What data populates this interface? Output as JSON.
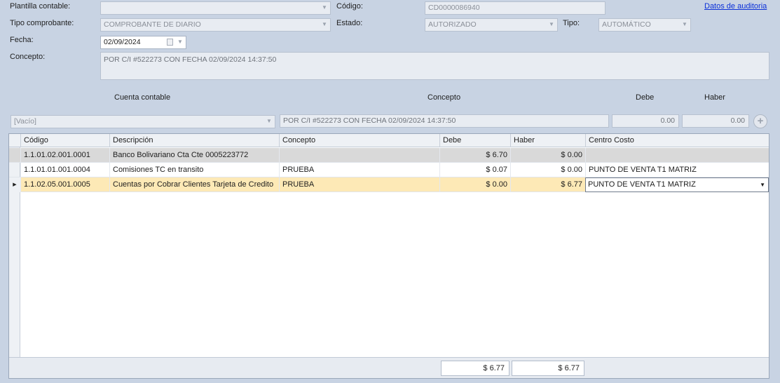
{
  "header": {
    "plantilla_label": "Plantilla contable:",
    "plantilla_value": "",
    "codigo_label": "Código:",
    "codigo_value": "CD0000086940",
    "auditoria_link": "Datos de auditoria",
    "tipo_comprobante_label": "Tipo comprobante:",
    "tipo_comprobante_value": "COMPROBANTE DE DIARIO",
    "estado_label": "Estado:",
    "estado_value": "AUTORIZADO",
    "tipo_label": "Tipo:",
    "tipo_value": "AUTOMÁTICO",
    "fecha_label": "Fecha:",
    "fecha_value": "02/09/2024",
    "concepto_label": "Concepto:",
    "concepto_value": "POR C/I #522273 CON FECHA 02/09/2024 14:37:50"
  },
  "entry": {
    "cuenta_header": "Cuenta contable",
    "concepto_header": "Concepto",
    "debe_header": "Debe",
    "haber_header": "Haber",
    "cuenta_value": "[Vacío]",
    "concepto_value": "POR C/I #522273 CON FECHA 02/09/2024 14:37:50",
    "debe_value": "0.00",
    "haber_value": "0.00",
    "add_icon": "plus-icon"
  },
  "grid": {
    "columns": {
      "codigo": "Código",
      "descripcion": "Descripción",
      "concepto": "Concepto",
      "debe": "Debe",
      "haber": "Haber",
      "centro": "Centro Costo"
    },
    "rows": [
      {
        "codigo": "1.1.01.02.001.0001",
        "descripcion": "Banco  Bolivariano Cta Cte 0005223772",
        "concepto": "",
        "debe": "$ 6.70",
        "haber": "$ 0.00",
        "centro": ""
      },
      {
        "codigo": "1.1.01.01.001.0004",
        "descripcion": "Comisiones TC en transito",
        "concepto": "PRUEBA",
        "debe": "$ 0.07",
        "haber": "$ 0.00",
        "centro": "PUNTO DE VENTA T1 MATRIZ"
      },
      {
        "codigo": "1.1.02.05.001.0005",
        "descripcion": "Cuentas por Cobrar Clientes Tarjeta de Credito",
        "concepto": "PRUEBA",
        "debe": "$ 0.00",
        "haber": "$ 6.77",
        "centro": "PUNTO DE VENTA T1 MATRIZ"
      }
    ],
    "total_debe": "$ 6.77",
    "total_haber": "$ 6.77"
  },
  "colors": {
    "background": "#c8d3e3",
    "selected_row": "#fde9b6",
    "link": "#0b30d8"
  }
}
